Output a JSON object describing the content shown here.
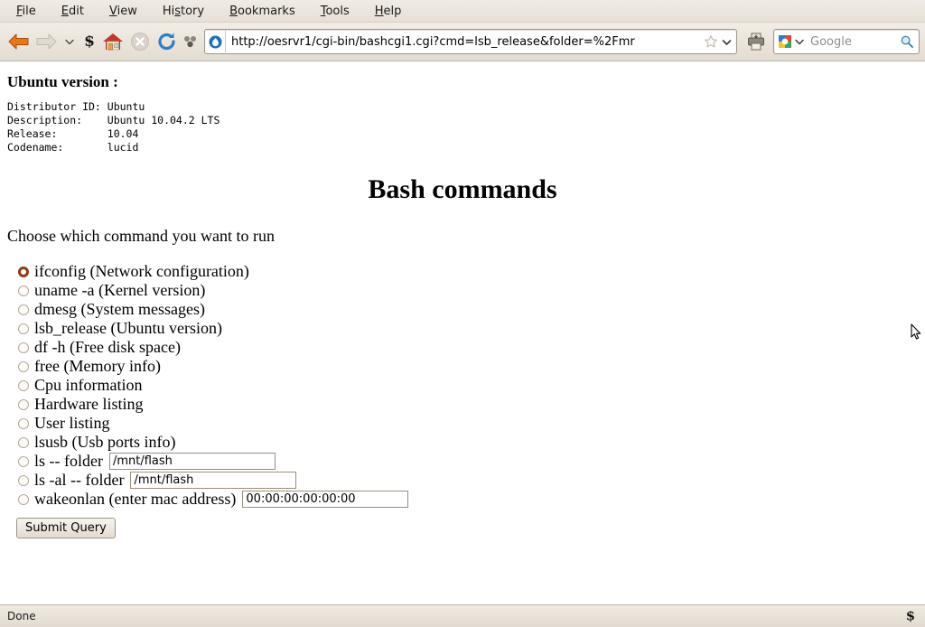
{
  "browser": {
    "menubar": [
      {
        "name": "file",
        "pre": "",
        "accel": "F",
        "post": "ile"
      },
      {
        "name": "edit",
        "pre": "",
        "accel": "E",
        "post": "dit"
      },
      {
        "name": "view",
        "pre": "",
        "accel": "V",
        "post": "iew"
      },
      {
        "name": "history",
        "pre": "Hi",
        "accel": "s",
        "post": "tory"
      },
      {
        "name": "bookmarks",
        "pre": "",
        "accel": "B",
        "post": "ookmarks"
      },
      {
        "name": "tools",
        "pre": "",
        "accel": "T",
        "post": "ools"
      },
      {
        "name": "help",
        "pre": "",
        "accel": "H",
        "post": "elp"
      }
    ],
    "toolbar": {
      "back_icon": "back-arrow-icon",
      "forward_icon": "forward-arrow-icon",
      "dropdown_icon": "chevron-down-icon",
      "script_icon": "noscript-s-icon",
      "home_icon": "home-icon",
      "stop_icon": "stop-close-icon",
      "reload_icon": "reload-icon",
      "extension_icon": "molecule-nodes-icon",
      "print_icon": "printer-icon"
    },
    "urlbar": {
      "favicon": "drupal-droplet-favicon",
      "url": "http://oesrvr1/cgi-bin/bashcgi1.cgi?cmd=lsb_release&folder=%2Fmr",
      "bookmark_icon": "star-outline-icon",
      "history_dropdown_icon": "chevron-down-icon"
    },
    "searchbar": {
      "engine_icon": "google-logo-icon",
      "engine_dropdown_icon": "chevron-down-icon",
      "placeholder": "Google",
      "search_icon": "magnifier-icon"
    },
    "statusbar": {
      "status": "Done",
      "noscript_icon": "noscript-s-icon"
    }
  },
  "page": {
    "section_title": "Ubuntu version :",
    "release_info": "Distributor ID: Ubuntu\nDescription:    Ubuntu 10.04.2 LTS\nRelease:        10.04\nCodename:       lucid",
    "heading": "Bash commands",
    "prompt": "Choose which command you want to run",
    "options": [
      {
        "name": "ifconfig",
        "label": "ifconfig (Network configuration)",
        "checked": true
      },
      {
        "name": "uname",
        "label": "uname -a (Kernel version)",
        "checked": false
      },
      {
        "name": "dmesg",
        "label": "dmesg (System messages)",
        "checked": false
      },
      {
        "name": "lsb-release",
        "label": "lsb_release (Ubuntu version)",
        "checked": false
      },
      {
        "name": "df",
        "label": "df -h (Free disk space)",
        "checked": false
      },
      {
        "name": "free",
        "label": "free (Memory info)",
        "checked": false
      },
      {
        "name": "cpuinfo",
        "label": "Cpu information",
        "checked": false
      },
      {
        "name": "hardware",
        "label": "Hardware listing",
        "checked": false
      },
      {
        "name": "users",
        "label": "User listing",
        "checked": false
      },
      {
        "name": "lsusb",
        "label": "lsusb (Usb ports info)",
        "checked": false
      }
    ],
    "input_options": [
      {
        "name": "ls-folder",
        "label": "ls -- folder",
        "value": "/mnt/flash",
        "checked": false
      },
      {
        "name": "ls-al-folder",
        "label": "ls -al -- folder",
        "value": "/mnt/flash",
        "checked": false
      },
      {
        "name": "wakeonlan",
        "label": "wakeonlan (enter mac address)",
        "value": "00:00:00:00:00:00",
        "checked": false
      }
    ],
    "submit_label": "Submit Query"
  },
  "colors": {
    "chrome_bg": "#e7e0d7",
    "radio_selected": "#8f3b10",
    "accent_orange": "#e8761a",
    "link_blue": "#2a6ebb"
  }
}
